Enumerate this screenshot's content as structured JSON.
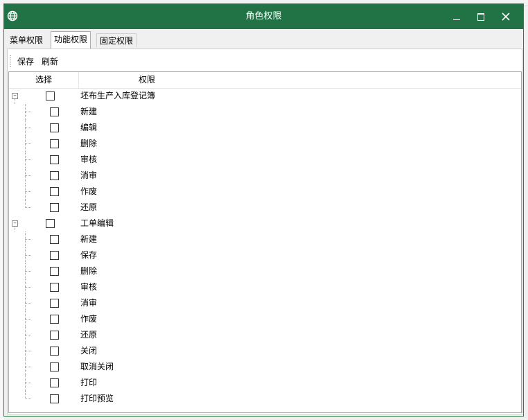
{
  "window": {
    "title": "角色权限"
  },
  "tabs": [
    {
      "label": "菜单权限",
      "active": false
    },
    {
      "label": "功能权限",
      "active": true
    },
    {
      "label": "固定权限",
      "active": false
    }
  ],
  "toolbar": {
    "save_label": "保存",
    "refresh_label": "刷新"
  },
  "grid": {
    "columns": [
      "选择",
      "权限"
    ],
    "groups": [
      {
        "label": "坯布生产入库登记簿",
        "checked": false,
        "expanded": true,
        "children": [
          {
            "label": "新建",
            "checked": false
          },
          {
            "label": "编辑",
            "checked": false
          },
          {
            "label": "删除",
            "checked": false
          },
          {
            "label": "审核",
            "checked": false
          },
          {
            "label": "消审",
            "checked": false
          },
          {
            "label": "作废",
            "checked": false
          },
          {
            "label": "还原",
            "checked": false
          }
        ]
      },
      {
        "label": "工单编辑",
        "checked": false,
        "expanded": true,
        "children": [
          {
            "label": "新建",
            "checked": false
          },
          {
            "label": "保存",
            "checked": false
          },
          {
            "label": "删除",
            "checked": false
          },
          {
            "label": "审核",
            "checked": false
          },
          {
            "label": "消审",
            "checked": false
          },
          {
            "label": "作废",
            "checked": false
          },
          {
            "label": "还原",
            "checked": false
          },
          {
            "label": "关闭",
            "checked": false
          },
          {
            "label": "取消关闭",
            "checked": false
          },
          {
            "label": "打印",
            "checked": false
          },
          {
            "label": "打印预览",
            "checked": false
          }
        ]
      }
    ]
  },
  "colors": {
    "titlebar": "#217346",
    "window_border": "#2f7a47"
  }
}
